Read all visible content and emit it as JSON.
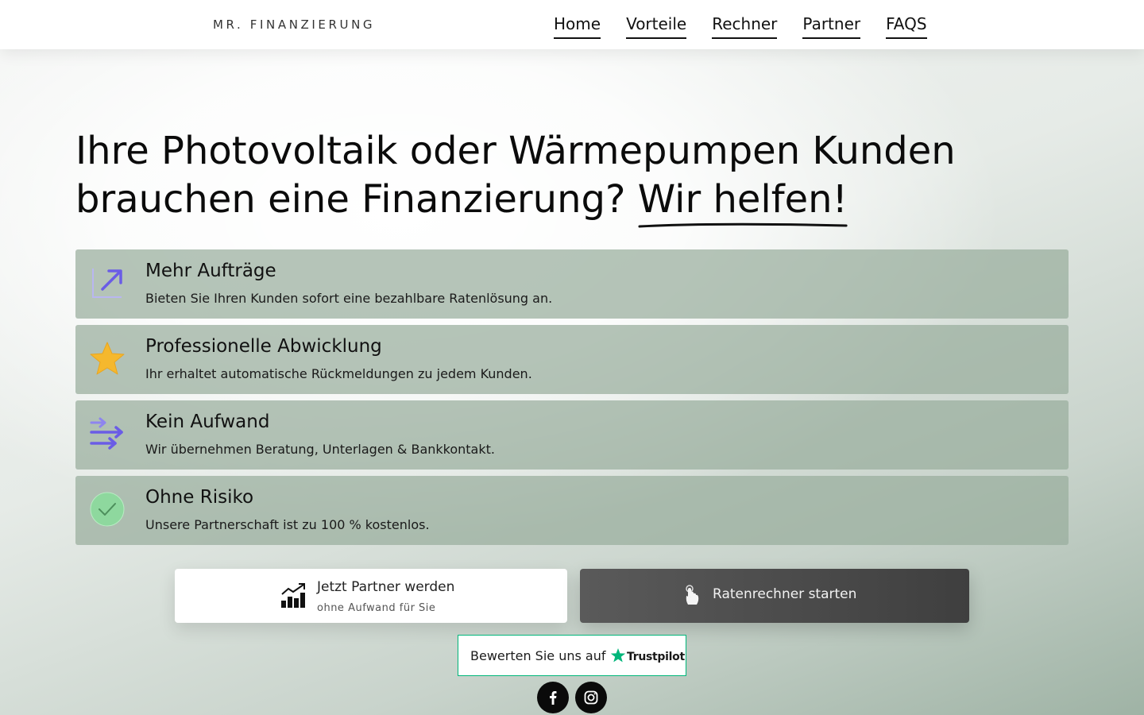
{
  "header": {
    "logo": "MR. FINANZIERUNG",
    "nav": [
      "Home",
      "Vorteile",
      "Rechner",
      "Partner",
      "FAQS"
    ]
  },
  "hero": {
    "title_line1": "Ihre Photovoltaik oder Wärmepumpen Kunden",
    "title_line2": "brauchen eine Finanzierung?",
    "title_highlight": "Wir helfen!"
  },
  "features": [
    {
      "icon": "trend-up-arrow-icon",
      "title": "Mehr Aufträge",
      "desc": "Bieten Sie Ihren Kunden sofort eine bezahlbare Ratenlösung an."
    },
    {
      "icon": "star-icon",
      "title": "Professionelle Abwicklung",
      "desc": "Ihr erhaltet automatische Rückmeldungen zu jedem Kunden."
    },
    {
      "icon": "arrows-right-icon",
      "title": "Kein Aufwand",
      "desc": "Wir übernehmen Beratung, Unterlagen & Bankkontakt."
    },
    {
      "icon": "check-circle-icon",
      "title": "Ohne Risiko",
      "desc": "Unsere Partnerschaft ist zu 100 % kostenlos."
    }
  ],
  "cta": {
    "partner_label": "Jetzt Partner werden",
    "partner_sub": "ohne Aufwand für Sie",
    "rechner_label": "Ratenrechner starten"
  },
  "trustpilot": {
    "text": "Bewerten Sie uns auf",
    "brand": "Trustpilot"
  },
  "social": [
    "facebook-icon",
    "instagram-icon"
  ],
  "colors": {
    "card_bg": "#98ad9d",
    "accent_purple": "#6a5ce6",
    "star_yellow": "#f5b82e",
    "check_green": "#8ed89e",
    "trustpilot_green": "#00b67a",
    "dark_button": "#4a4a4a"
  }
}
